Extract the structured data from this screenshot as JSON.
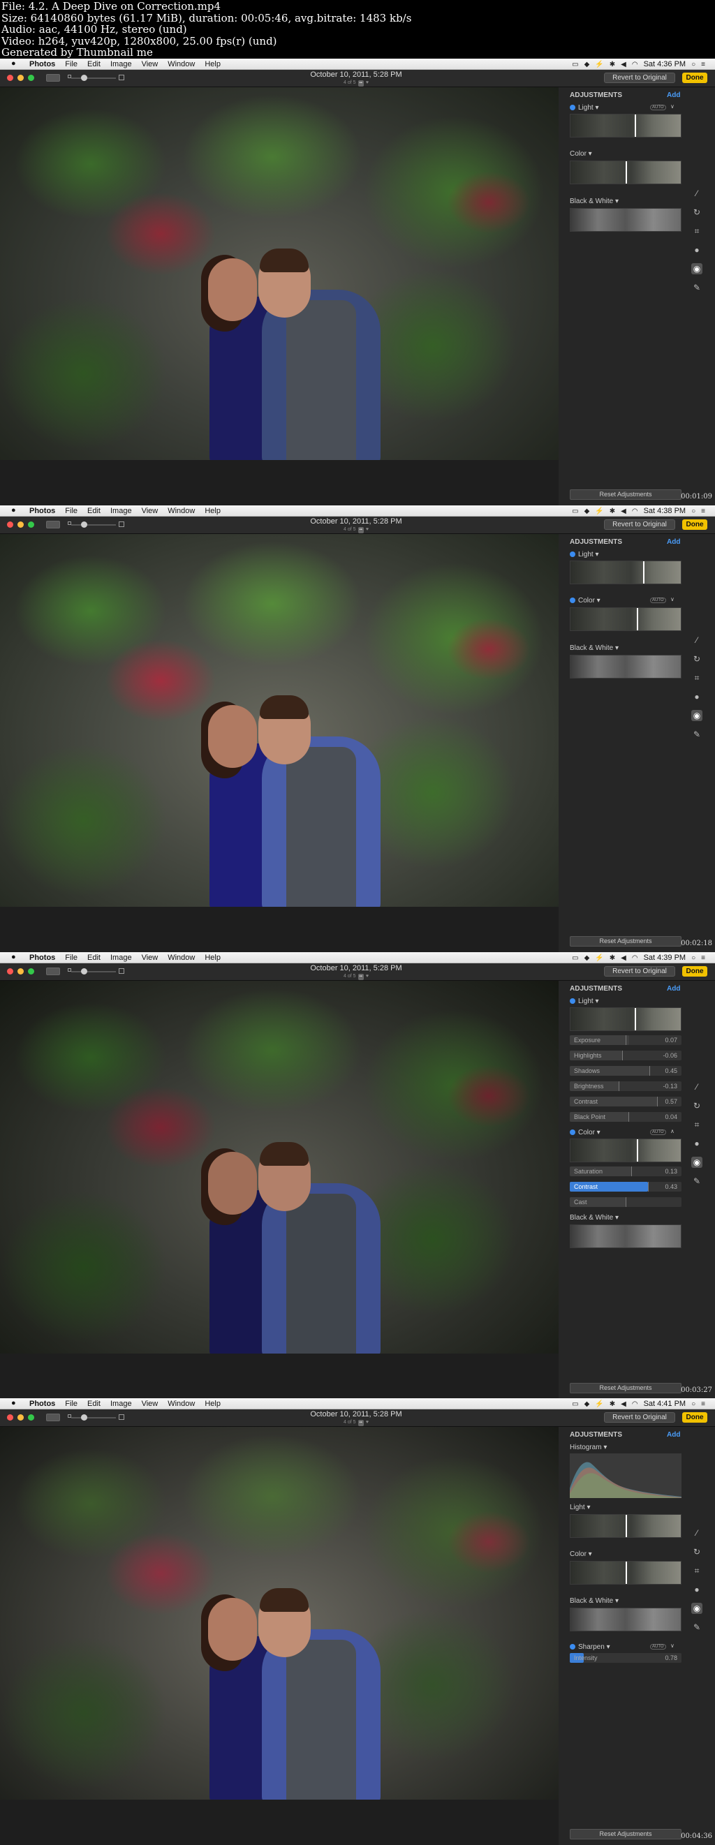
{
  "header_info": {
    "line1": "File: 4.2. A Deep Dive on Correction.mp4",
    "line2": "Size: 64140860 bytes (61.17 MiB), duration: 00:05:46, avg.bitrate: 1483 kb/s",
    "line3": "Audio: aac, 44100 Hz, stereo (und)",
    "line4": "Video: h264, yuv420p, 1280x800, 25.00 fps(r) (und)",
    "line5": "Generated by Thumbnail me"
  },
  "menubar": {
    "app": "Photos",
    "items": [
      "File",
      "Edit",
      "Image",
      "View",
      "Window",
      "Help"
    ]
  },
  "toolbar": {
    "date": "October 10, 2011, 5:28 PM",
    "count": "4 of 5",
    "revert_label": "Revert to Original",
    "done_label": "Done"
  },
  "panel": {
    "title": "ADJUSTMENTS",
    "add_label": "Add",
    "reset_label": "Reset Adjustments",
    "auto_label": "AUTO"
  },
  "frames": [
    {
      "time": "Sat 4:36 PM",
      "timestamp": "00:01:09",
      "sections": {
        "light": "Light",
        "color": "Color",
        "bw": "Black & White"
      }
    },
    {
      "time": "Sat 4:38 PM",
      "timestamp": "00:02:18",
      "sections": {
        "light": "Light",
        "color": "Color",
        "bw": "Black & White"
      }
    },
    {
      "time": "Sat 4:39 PM",
      "timestamp": "00:03:27",
      "sections": {
        "light": "Light",
        "color": "Color",
        "bw": "Black & White"
      },
      "light_sliders": [
        {
          "label": "Exposure",
          "value": "0.07"
        },
        {
          "label": "Highlights",
          "value": "-0.06"
        },
        {
          "label": "Shadows",
          "value": "0.45"
        },
        {
          "label": "Brightness",
          "value": "-0.13"
        },
        {
          "label": "Contrast",
          "value": "0.57"
        },
        {
          "label": "Black Point",
          "value": "0.04"
        }
      ],
      "color_sliders": [
        {
          "label": "Saturation",
          "value": "0.13"
        },
        {
          "label": "Contrast",
          "value": "0.43"
        },
        {
          "label": "Cast",
          "value": ""
        }
      ]
    },
    {
      "time": "Sat 4:41 PM",
      "timestamp": "00:04:36",
      "sections": {
        "histogram": "Histogram",
        "light": "Light",
        "color": "Color",
        "bw": "Black & White",
        "sharpen": "Sharpen"
      },
      "sharpen_slider": {
        "label": "Intensity",
        "value": "0.78"
      }
    }
  ],
  "colors": {
    "accent": "#3b8cf0",
    "done": "#f2c200",
    "panel": "#262626"
  }
}
